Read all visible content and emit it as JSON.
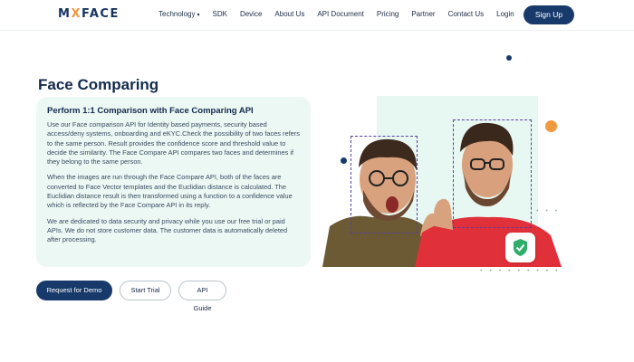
{
  "nav": {
    "logo_pre": "M",
    "logo_x": "X",
    "logo_post": "FACE",
    "items": [
      "Technology",
      "SDK",
      "Device",
      "About Us",
      "API Document",
      "Pricing",
      "Partner",
      "Contact Us",
      "Login"
    ],
    "signup": "Sign Up"
  },
  "hero": {
    "title": "Face Comparing",
    "card": {
      "heading": "Perform 1:1 Comparison with Face Comparing API",
      "p1": "Use our Face comparison API for Identity based payments, security based access/deny systems, onboarding and eKYC.Check the possibility of two faces refers to the same person. Result provides the confidence score and threshold value to decide the similarity. The Face Compare API compares two faces and determines if they belong to the same person.",
      "p2": "When the images are run through the Face Compare API, both of the faces are converted to Face Vector templates and the Euclidian distance is calculated. The Euclidian distance result is then transformed using a function to a confidence value which is reflected by the Face Compare API in its reply.",
      "p3": "We are dedicated to data security and privacy while you use our free trial or paid APIs. We do not store customer data. The customer data is automatically deleted after processing."
    },
    "buttons": {
      "demo": "Request for Demo",
      "trial": "Start Trial",
      "guide": "API Guide"
    }
  },
  "colors": {
    "primary": "#173a6b",
    "accent": "#f0993f",
    "mint": "#ecf8f3",
    "frame": "#5b3fa0",
    "shirt": "#e0303a",
    "shield": "#2fae6a"
  },
  "icons": [
    "chevron-down-icon",
    "shield-check-icon"
  ]
}
